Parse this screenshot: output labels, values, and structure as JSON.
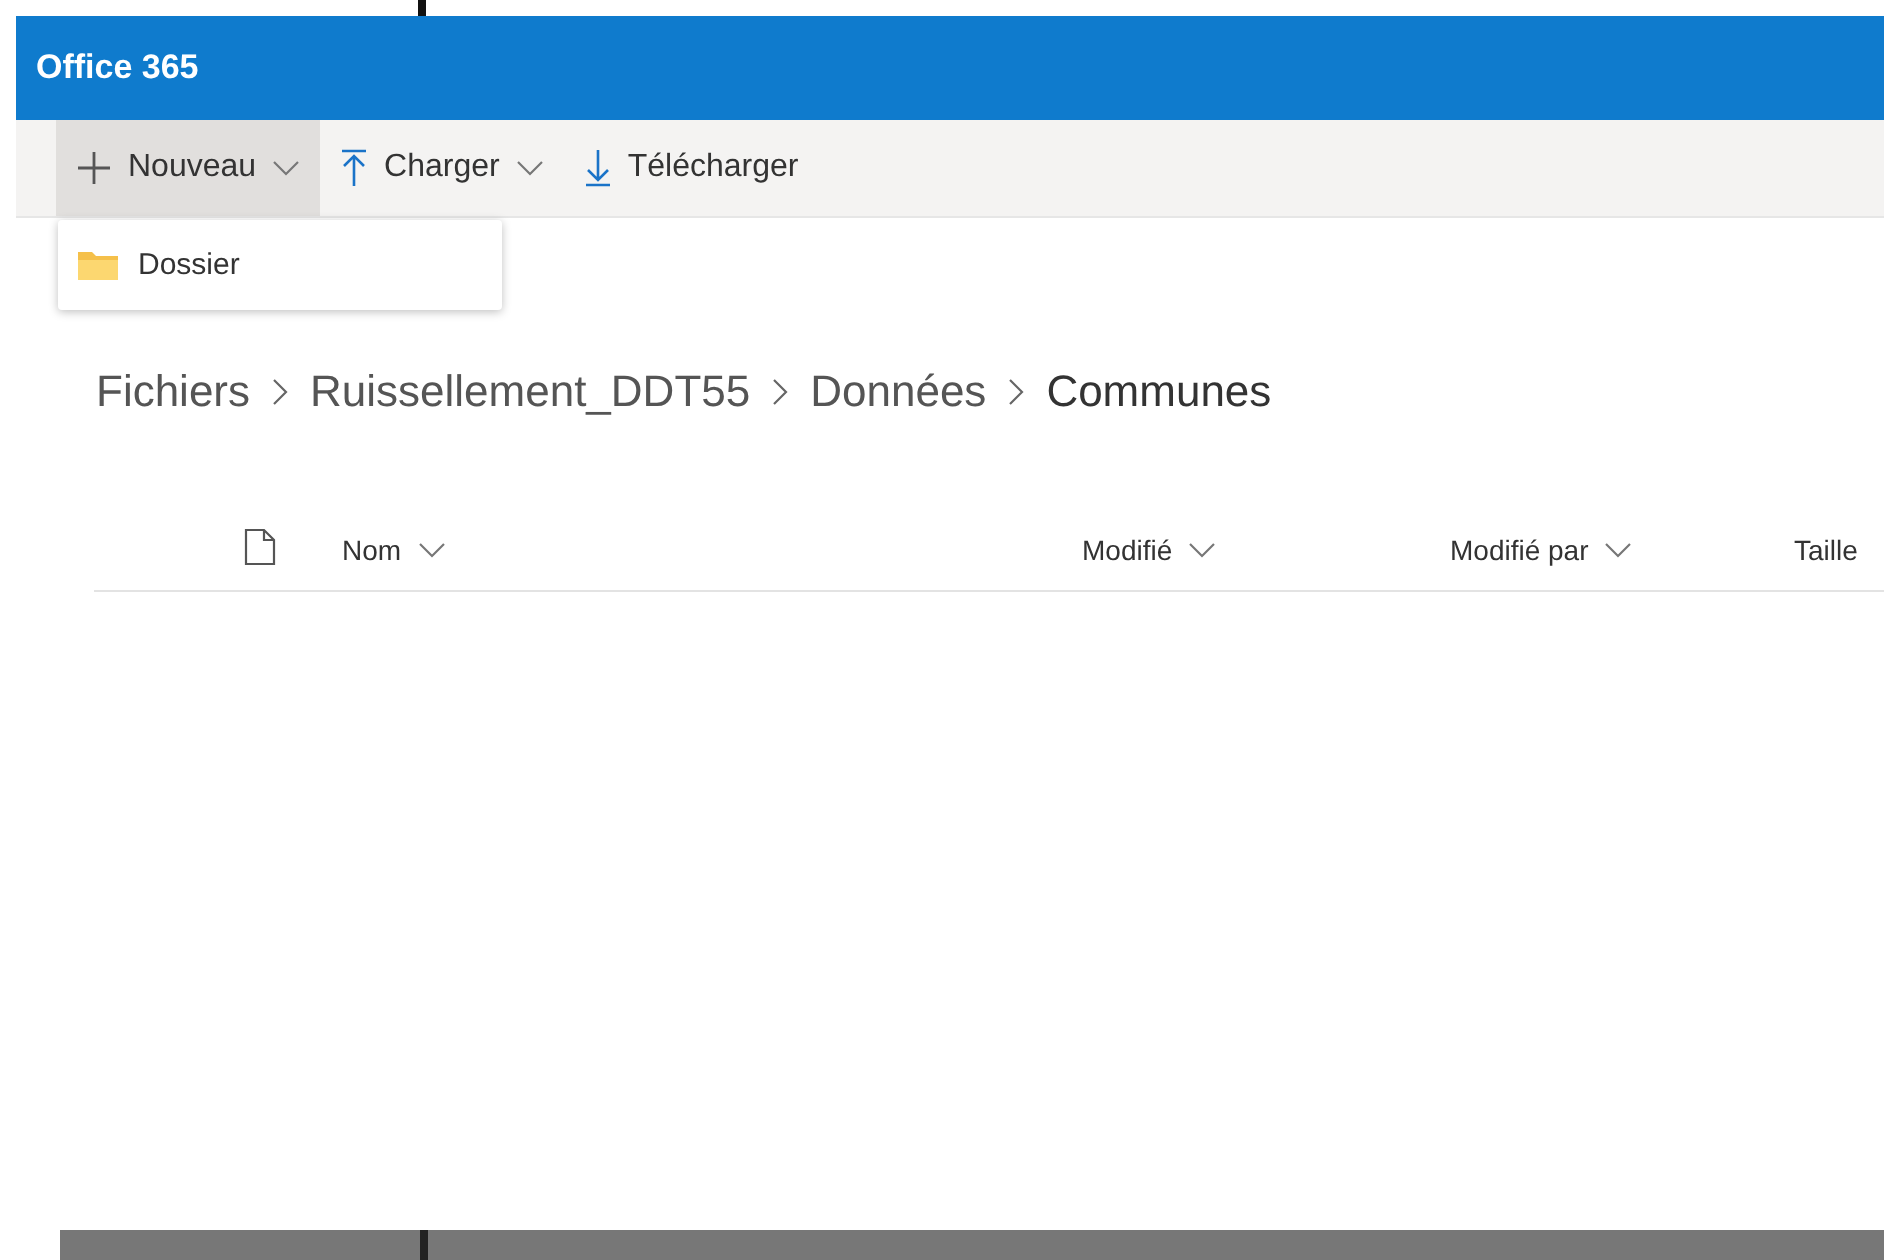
{
  "header": {
    "title": "Office 365"
  },
  "toolbar": [
    {
      "kind": "new",
      "label": "Nouveau",
      "dropdown": true,
      "expanded": true
    },
    {
      "kind": "upload",
      "label": "Charger",
      "dropdown": true,
      "expanded": false
    },
    {
      "kind": "download",
      "label": "Télécharger",
      "dropdown": false,
      "expanded": false
    }
  ],
  "menu": [
    {
      "kind": "folder",
      "label": "Dossier"
    }
  ],
  "breadcrumb": [
    "Fichiers",
    "Ruissellement_DDT55",
    "Données",
    "Communes"
  ],
  "columns": [
    {
      "kind": "icon"
    },
    {
      "kind": "text",
      "label": "Nom",
      "sortable": true
    },
    {
      "kind": "text",
      "label": "Modifié",
      "sortable": true
    },
    {
      "kind": "text",
      "label": "Modifié par",
      "sortable": true
    },
    {
      "kind": "text",
      "label": "Taille",
      "sortable": false
    }
  ]
}
